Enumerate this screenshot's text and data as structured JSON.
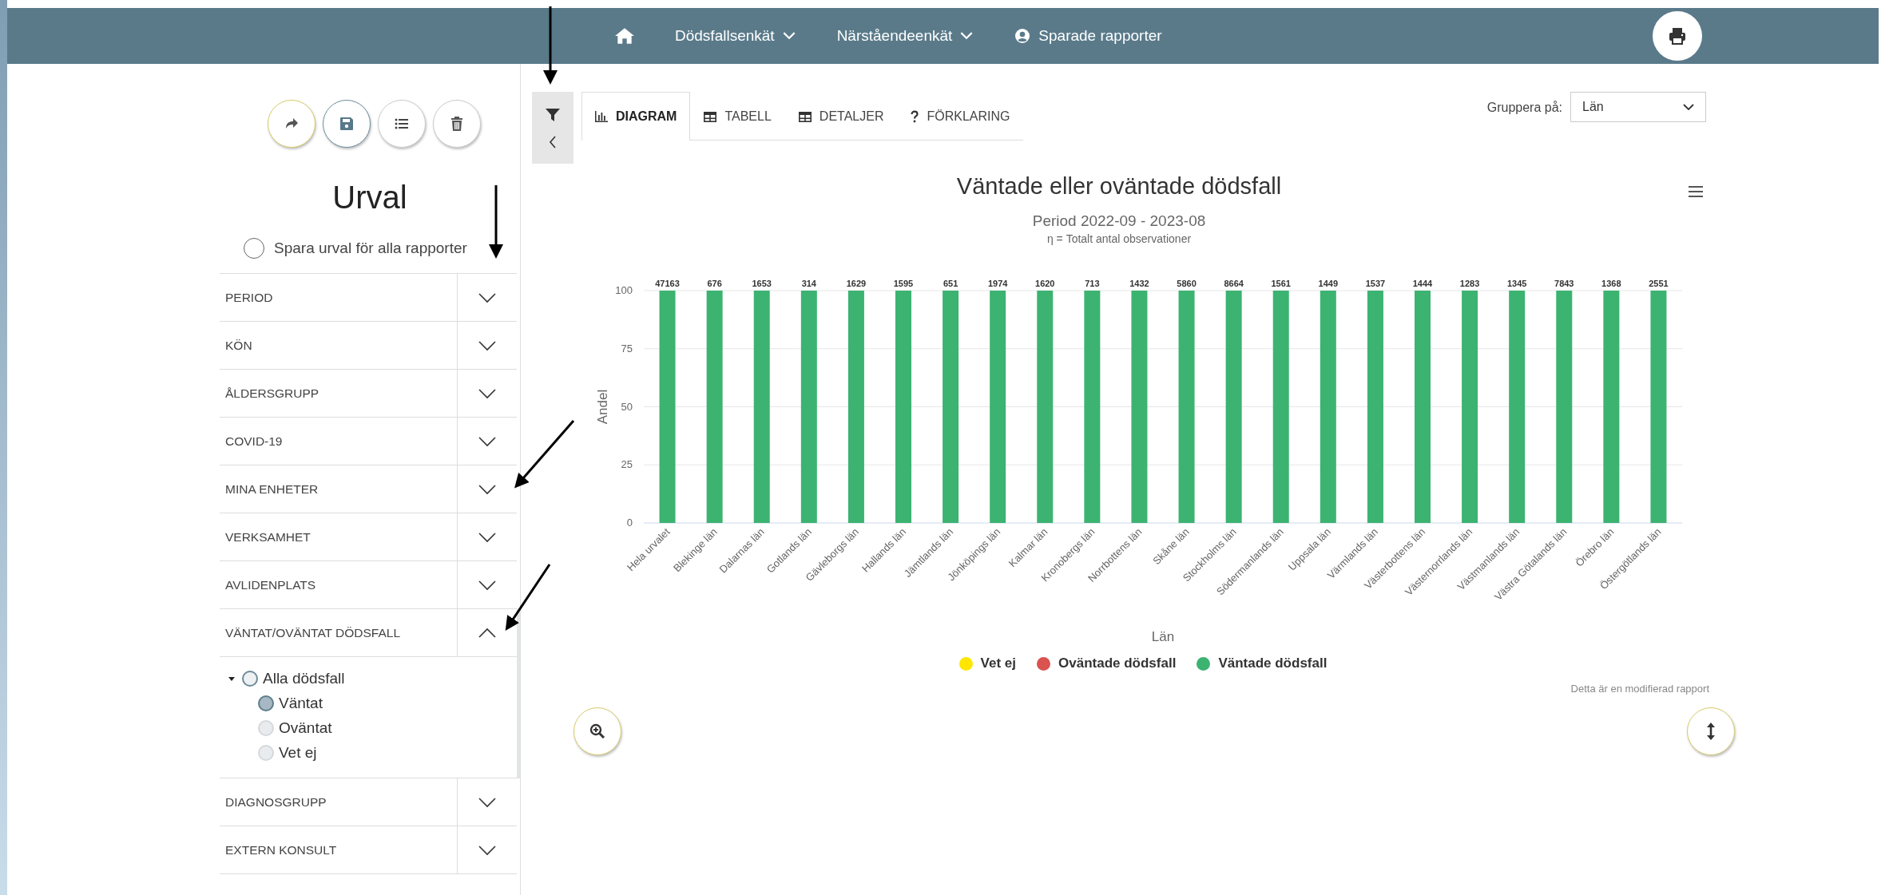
{
  "nav": {
    "items": [
      {
        "kind": "dropdown",
        "label": "Dödsfallsenkät"
      },
      {
        "kind": "dropdown",
        "label": "Närståendeenkät"
      },
      {
        "kind": "user",
        "label": "Sparade rapporter"
      }
    ]
  },
  "sidebar": {
    "title": "Urval",
    "save_all": {
      "label": "Spara urval för alla rapporter",
      "checked": false
    },
    "filters": [
      {
        "label": "PERIOD",
        "expanded": false
      },
      {
        "label": "KÖN",
        "expanded": false
      },
      {
        "label": "ÅLDERSGRUPP",
        "expanded": false
      },
      {
        "label": "COVID-19",
        "expanded": false
      },
      {
        "label": "MINA ENHETER",
        "expanded": false
      },
      {
        "label": "VERKSAMHET",
        "expanded": false
      },
      {
        "label": "AVLIDENPLATS",
        "expanded": false
      },
      {
        "label": "VÄNTAT/OVÄNTAT DÖDSFALL",
        "expanded": true,
        "options": [
          {
            "label": "Alla dödsfall",
            "expanded": true,
            "selected": false,
            "children": [
              {
                "label": "Väntat",
                "selected": true
              },
              {
                "label": "Oväntat",
                "selected": false
              },
              {
                "label": "Vet ej",
                "selected": false
              }
            ]
          }
        ]
      },
      {
        "label": "DIAGNOSGRUPP",
        "expanded": false
      },
      {
        "label": "EXTERN KONSULT",
        "expanded": false
      }
    ]
  },
  "tabs": [
    {
      "kind": "chart",
      "label": "DIAGRAM",
      "selected": true
    },
    {
      "kind": "table",
      "label": "TABELL",
      "selected": false
    },
    {
      "kind": "table",
      "label": "DETALJER",
      "selected": false
    },
    {
      "kind": "help",
      "label": "FÖRKLARING",
      "selected": false
    }
  ],
  "group_by": {
    "label": "Gruppera på:",
    "value": "Län"
  },
  "chart": {
    "subtitle": "Period 2022-09 - 2023-08",
    "note": "η = Totalt antal observationer",
    "footnote": "Detta är en modifierad rapport",
    "chart_data": {
      "type": "bar",
      "title": "Väntade eller oväntade dödsfall",
      "xlabel": "Län",
      "ylabel": "Andel",
      "stacked": true,
      "grid": true,
      "ylim": [
        0,
        100
      ],
      "yticks": [
        0,
        25,
        50,
        75,
        100
      ],
      "categories": [
        "Hela urvalet",
        "Blekinge län",
        "Dalarnas län",
        "Gotlands län",
        "Gävleborgs län",
        "Hallands län",
        "Jämtlands län",
        "Jönköpings län",
        "Kalmar län",
        "Kronobergs län",
        "Norrbottens län",
        "Skåne län",
        "Stockholms län",
        "Södermanlands län",
        "Uppsala län",
        "Värmlands län",
        "Västerbottens län",
        "Västernorrlands län",
        "Västmanlands län",
        "Västra Götalands län",
        "Örebro län",
        "Östergötlands län"
      ],
      "value_labels": [
        "47163",
        "676",
        "1653",
        "314",
        "1629",
        "1595",
        "651",
        "1974",
        "1620",
        "713",
        "1432",
        "5860",
        "8664",
        "1561",
        "1449",
        "1537",
        "1444",
        "1283",
        "1345",
        "7843",
        "1368",
        "2551"
      ],
      "series": [
        {
          "name": "Vet ej",
          "color": "#ffe600",
          "values": [
            0,
            0,
            0,
            0,
            0,
            0,
            0,
            0,
            0,
            0,
            0,
            0,
            0,
            0,
            0,
            0,
            0,
            0,
            0,
            0,
            0,
            0
          ]
        },
        {
          "name": "Oväntade dödsfall",
          "color": "#d9534f",
          "values": [
            0,
            0,
            0,
            0,
            0,
            0,
            0,
            0,
            0,
            0,
            0,
            0,
            0,
            0,
            0,
            0,
            0,
            0,
            0,
            0,
            0,
            0
          ]
        },
        {
          "name": "Väntade dödsfall",
          "color": "#3cb371",
          "values": [
            100,
            100,
            100,
            100,
            100,
            100,
            100,
            100,
            100,
            100,
            100,
            100,
            100,
            100,
            100,
            100,
            100,
            100,
            100,
            100,
            100,
            100
          ]
        }
      ]
    }
  }
}
